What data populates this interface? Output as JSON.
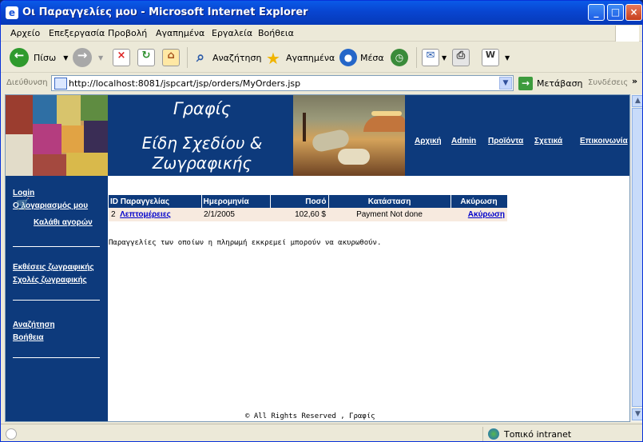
{
  "window": {
    "title": "Οι Παραγγελίες μου - Microsoft Internet Explorer",
    "minimize": "_",
    "maximize": "□",
    "close": "×"
  },
  "menu": [
    "Αρχείο",
    "Επεξεργασία",
    "Προβολή",
    "Αγαπημένα",
    "Εργαλεία",
    "Βοήθεια"
  ],
  "toolbar": {
    "back": "Πίσω",
    "search": "Αναζήτηση",
    "favorites": "Αγαπημένα",
    "media": "Μέσα"
  },
  "address": {
    "label": "Διεύθυνση",
    "url": "http://localhost:8081/jspcart/jsp/orders/MyOrders.jsp",
    "go": "Μετάβαση",
    "links": "Συνδέσεις"
  },
  "site": {
    "title": "Γραφίς",
    "subtitle": "Είδη Σχεδίου & Ζωγραφικής",
    "nav": [
      "Αρχική",
      "Admin",
      "Προϊόντα",
      "Σχετικά",
      "Επικοινωνία"
    ]
  },
  "sidebar": {
    "links1": [
      "Login",
      "Ο λογαριασμός μου",
      "Καλάθι αγορών"
    ],
    "links2": [
      "Εκθέσεις ζωγραφικής",
      "Σχολές ζωγραφικής"
    ],
    "links3": [
      "Αναζήτηση",
      "Βοήθεια"
    ]
  },
  "orders_table": {
    "headers": [
      "ID Παραγγελίας",
      "Ημερομηνία",
      "Ποσό",
      "Κατάσταση",
      "Ακύρωση"
    ],
    "rows": [
      {
        "id": "2",
        "details": "Λεπτομέρειες",
        "date": "2/1/2005",
        "amount": "102,60 $",
        "status": "Payment Not done",
        "cancel": "Ακύρωση"
      }
    ]
  },
  "note": "Παραγγελίες των οποίων η πληρωμή εκκρεμεί μπορούν να ακυρωθούν.",
  "footer": "© All Rights Reserved , Γραφίς",
  "status": {
    "zone": "Τοπικό intranet"
  },
  "icons": {
    "window": "ie-icon",
    "back": "back-icon",
    "forward": "forward-icon",
    "stop": "stop-icon",
    "refresh": "refresh-icon",
    "home": "home-icon",
    "search": "search-icon",
    "favorites": "star-icon",
    "media": "media-icon",
    "history": "history-icon",
    "mail": "mail-icon",
    "print": "print-icon",
    "edit": "edit-icon"
  },
  "colors": {
    "site_blue": "#0d3a7c",
    "table_row": "#f7eadf",
    "link_blue": "#0000cc"
  }
}
